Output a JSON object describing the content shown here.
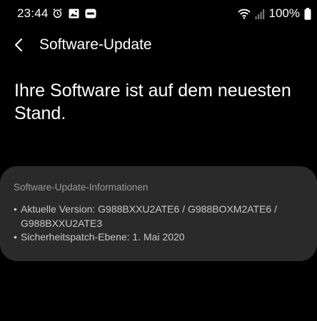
{
  "status_bar": {
    "time": "23:44",
    "battery": "100%",
    "icons_left": [
      "alarm-icon",
      "image-icon",
      "dex-icon"
    ],
    "icons_right": [
      "wifi-icon",
      "signal-icon"
    ]
  },
  "header": {
    "back_icon": "back-arrow-icon",
    "title": "Software-Update"
  },
  "main": {
    "headline": "Ihre Software ist auf dem neuesten Stand."
  },
  "info_card": {
    "title": "Software-Update-Informationen",
    "bullet": "•",
    "items": [
      {
        "text": "Aktuelle Version: G988BXXU2ATE6 / G988BOXM2ATE6 / G988BXXU2ATE3"
      },
      {
        "text": "Sicherheitspatch-Ebene: 1. Mai 2020"
      }
    ]
  },
  "colors": {
    "background": "#000000",
    "card": "#2a2a2a",
    "text_primary": "#ffffff",
    "text_secondary": "#c8c8c8",
    "text_muted": "#9a9a9a"
  }
}
